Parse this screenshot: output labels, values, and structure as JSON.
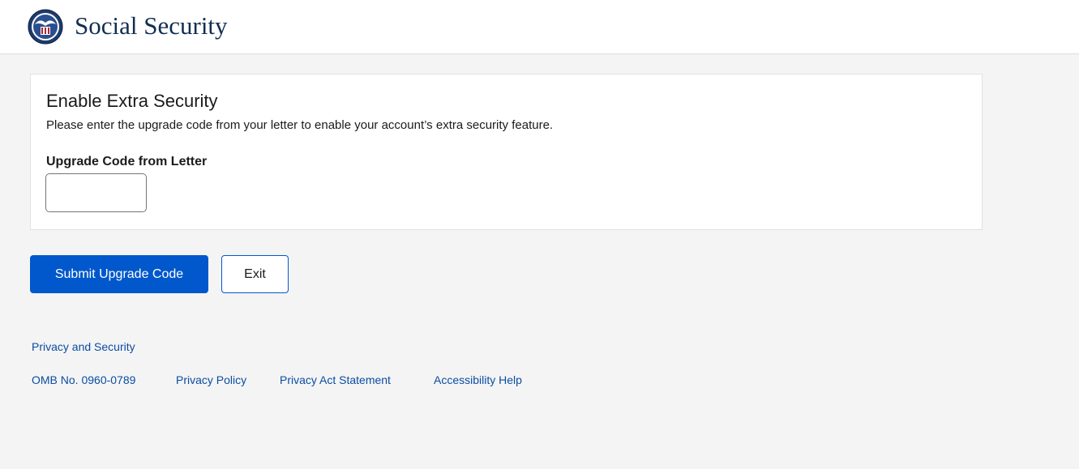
{
  "header": {
    "brand": "Social Security"
  },
  "card": {
    "title": "Enable Extra Security",
    "description": "Please enter the upgrade code from your letter to enable your account’s extra security feature.",
    "field_label": "Upgrade Code from Letter",
    "field_value": ""
  },
  "actions": {
    "submit_label": "Submit Upgrade Code",
    "exit_label": "Exit"
  },
  "footer": {
    "privacy_security": "Privacy and Security",
    "omb": "OMB No. 0960-0789",
    "privacy_policy": "Privacy Policy",
    "privacy_act": "Privacy Act Statement",
    "accessibility": "Accessibility Help"
  },
  "colors": {
    "primary": "#0058cc",
    "link": "#0a4da2",
    "brand": "#112e51",
    "page_bg": "#f4f4f4"
  },
  "icons": {
    "logo": "ssa-seal-icon"
  }
}
